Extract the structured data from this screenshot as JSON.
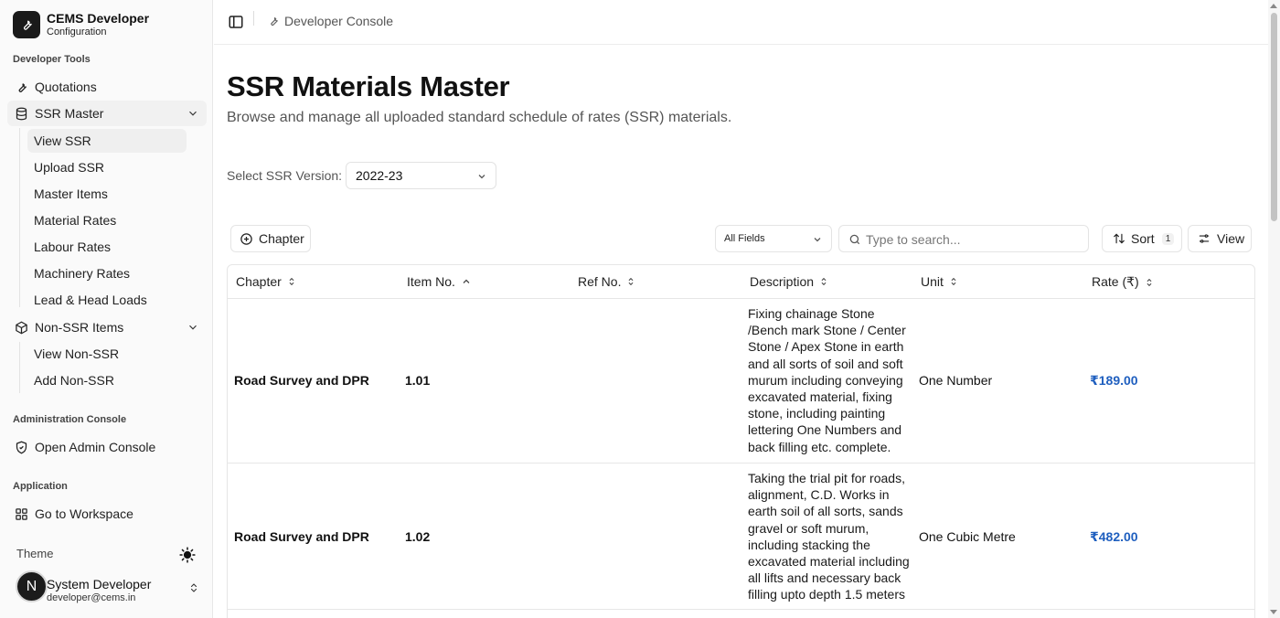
{
  "brand": {
    "title": "CEMS Developer",
    "subtitle": "Configuration"
  },
  "sidebar": {
    "sections": {
      "developer_tools": "Developer Tools",
      "administration": "Administration Console",
      "application": "Application"
    },
    "items": {
      "quotations": "Quotations",
      "ssr_master": "SSR Master",
      "non_ssr_items": "Non-SSR Items",
      "open_admin": "Open Admin Console",
      "workspace": "Go to Workspace"
    },
    "ssr_sub": [
      "View SSR",
      "Upload SSR",
      "Master Items",
      "Material Rates",
      "Labour Rates",
      "Machinery Rates",
      "Lead & Head Loads"
    ],
    "non_ssr_sub": [
      "View Non-SSR",
      "Add Non-SSR"
    ],
    "theme_label": "Theme",
    "user": {
      "initial": "N",
      "name": "System Developer",
      "email": "developer@cems.in"
    }
  },
  "topbar": {
    "breadcrumb": "Developer Console"
  },
  "main": {
    "title": "SSR Materials Master",
    "subtitle": "Browse and manage all uploaded standard schedule of rates (SSR) materials.",
    "version_label": "Select SSR Version:",
    "version_value": "2022-23",
    "toolbar": {
      "chapter_button": "Chapter",
      "field_select": "All Fields",
      "search_placeholder": "Type to search...",
      "sort_label": "Sort",
      "sort_count": "1",
      "view_label": "View"
    },
    "table": {
      "headers": {
        "chapter": "Chapter",
        "item_no": "Item No.",
        "ref_no": "Ref No.",
        "description": "Description",
        "unit": "Unit",
        "rate": "Rate (₹)"
      },
      "rows": [
        {
          "chapter": "Road Survey and DPR",
          "item_no": "1.01",
          "ref_no": "",
          "description": "Fixing chainage Stone /Bench mark Stone / Center Stone / Apex Stone in earth and all sorts of soil and soft murum including conveying excavated material, fixing stone, including painting lettering One Numbers and back filling etc. complete.",
          "unit": "One Number",
          "rate": "₹189.00"
        },
        {
          "chapter": "Road Survey and DPR",
          "item_no": "1.02",
          "ref_no": "",
          "description": "Taking the trial pit for roads, alignment, C.D. Works in earth soil of all sorts, sands gravel or soft murum, including stacking the excavated material including all lifts and necessary back filling upto depth 1.5 meters",
          "unit": "One Cubic Metre",
          "rate": "₹482.00"
        }
      ]
    }
  }
}
